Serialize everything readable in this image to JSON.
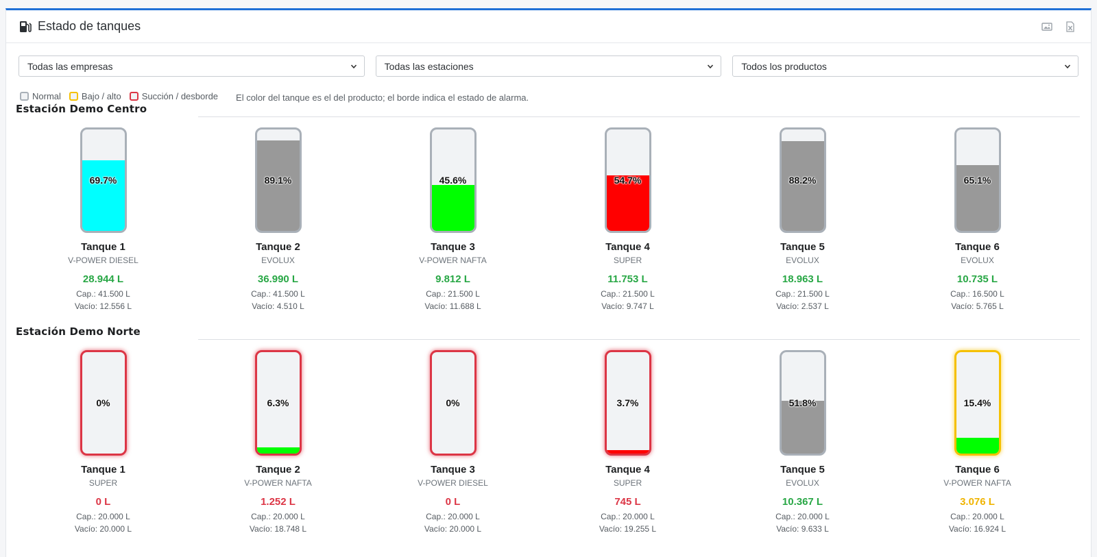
{
  "header": {
    "title": "Estado de tanques"
  },
  "filters": [
    {
      "value": "Todas las empresas"
    },
    {
      "value": "Todas las estaciones"
    },
    {
      "value": "Todos los productos"
    }
  ],
  "legend": {
    "items": [
      {
        "label": "Normal",
        "color": "#a9b0b8"
      },
      {
        "label": "Bajo / alto",
        "color": "#f5c000"
      },
      {
        "label": "Succión / desborde",
        "color": "#dc3545"
      }
    ],
    "note": "El color del tanque es el del producto; el borde indica el estado de alarma."
  },
  "stations": [
    {
      "name": "Estación Demo Centro",
      "tanks": [
        {
          "name": "Tanque 1",
          "product": "V-POWER DIESEL",
          "pct": "69.7%",
          "level": 0.697,
          "fill": "#00ffff",
          "alarm": "normal",
          "volume": "28.944 L",
          "volume_status": "ok",
          "cap": "Cap.: 41.500 L",
          "empty": "Vacío: 12.556 L"
        },
        {
          "name": "Tanque 2",
          "product": "EVOLUX",
          "pct": "89.1%",
          "level": 0.891,
          "fill": "#999999",
          "alarm": "normal",
          "volume": "36.990 L",
          "volume_status": "ok",
          "cap": "Cap.: 41.500 L",
          "empty": "Vacío: 4.510 L"
        },
        {
          "name": "Tanque 3",
          "product": "V-POWER NAFTA",
          "pct": "45.6%",
          "level": 0.456,
          "fill": "#00ff00",
          "alarm": "normal",
          "volume": "9.812 L",
          "volume_status": "ok",
          "cap": "Cap.: 21.500 L",
          "empty": "Vacío: 11.688 L"
        },
        {
          "name": "Tanque 4",
          "product": "SUPER",
          "pct": "54.7%",
          "level": 0.547,
          "fill": "#ff0000",
          "alarm": "normal",
          "volume": "11.753 L",
          "volume_status": "ok",
          "cap": "Cap.: 21.500 L",
          "empty": "Vacío: 9.747 L"
        },
        {
          "name": "Tanque 5",
          "product": "EVOLUX",
          "pct": "88.2%",
          "level": 0.882,
          "fill": "#999999",
          "alarm": "normal",
          "volume": "18.963 L",
          "volume_status": "ok",
          "cap": "Cap.: 21.500 L",
          "empty": "Vacío: 2.537 L"
        },
        {
          "name": "Tanque 6",
          "product": "EVOLUX",
          "pct": "65.1%",
          "level": 0.651,
          "fill": "#999999",
          "alarm": "normal",
          "volume": "10.735 L",
          "volume_status": "ok",
          "cap": "Cap.: 16.500 L",
          "empty": "Vacío: 5.765 L"
        }
      ]
    },
    {
      "name": "Estación Demo Norte",
      "tanks": [
        {
          "name": "Tanque 1",
          "product": "SUPER",
          "pct": "0%",
          "level": 0.0,
          "fill": "#ff0000",
          "alarm": "red",
          "volume": "0 L",
          "volume_status": "bad",
          "cap": "Cap.: 20.000 L",
          "empty": "Vacío: 20.000 L"
        },
        {
          "name": "Tanque 2",
          "product": "V-POWER NAFTA",
          "pct": "6.3%",
          "level": 0.063,
          "fill": "#00ff00",
          "alarm": "red",
          "volume": "1.252 L",
          "volume_status": "bad",
          "cap": "Cap.: 20.000 L",
          "empty": "Vacío: 18.748 L"
        },
        {
          "name": "Tanque 3",
          "product": "V-POWER DIESEL",
          "pct": "0%",
          "level": 0.0,
          "fill": "#00ffff",
          "alarm": "red",
          "volume": "0 L",
          "volume_status": "bad",
          "cap": "Cap.: 20.000 L",
          "empty": "Vacío: 20.000 L"
        },
        {
          "name": "Tanque 4",
          "product": "SUPER",
          "pct": "3.7%",
          "level": 0.037,
          "fill": "#ff0000",
          "alarm": "red",
          "volume": "745 L",
          "volume_status": "bad",
          "cap": "Cap.: 20.000 L",
          "empty": "Vacío: 19.255 L"
        },
        {
          "name": "Tanque 5",
          "product": "EVOLUX",
          "pct": "51.8%",
          "level": 0.518,
          "fill": "#999999",
          "alarm": "normal",
          "volume": "10.367 L",
          "volume_status": "ok",
          "cap": "Cap.: 20.000 L",
          "empty": "Vacío: 9.633 L"
        },
        {
          "name": "Tanque 6",
          "product": "V-POWER NAFTA",
          "pct": "15.4%",
          "level": 0.154,
          "fill": "#00ff00",
          "alarm": "yellow",
          "volume": "3.076 L",
          "volume_status": "warn",
          "cap": "Cap.: 20.000 L",
          "empty": "Vacío: 16.924 L"
        }
      ]
    }
  ]
}
